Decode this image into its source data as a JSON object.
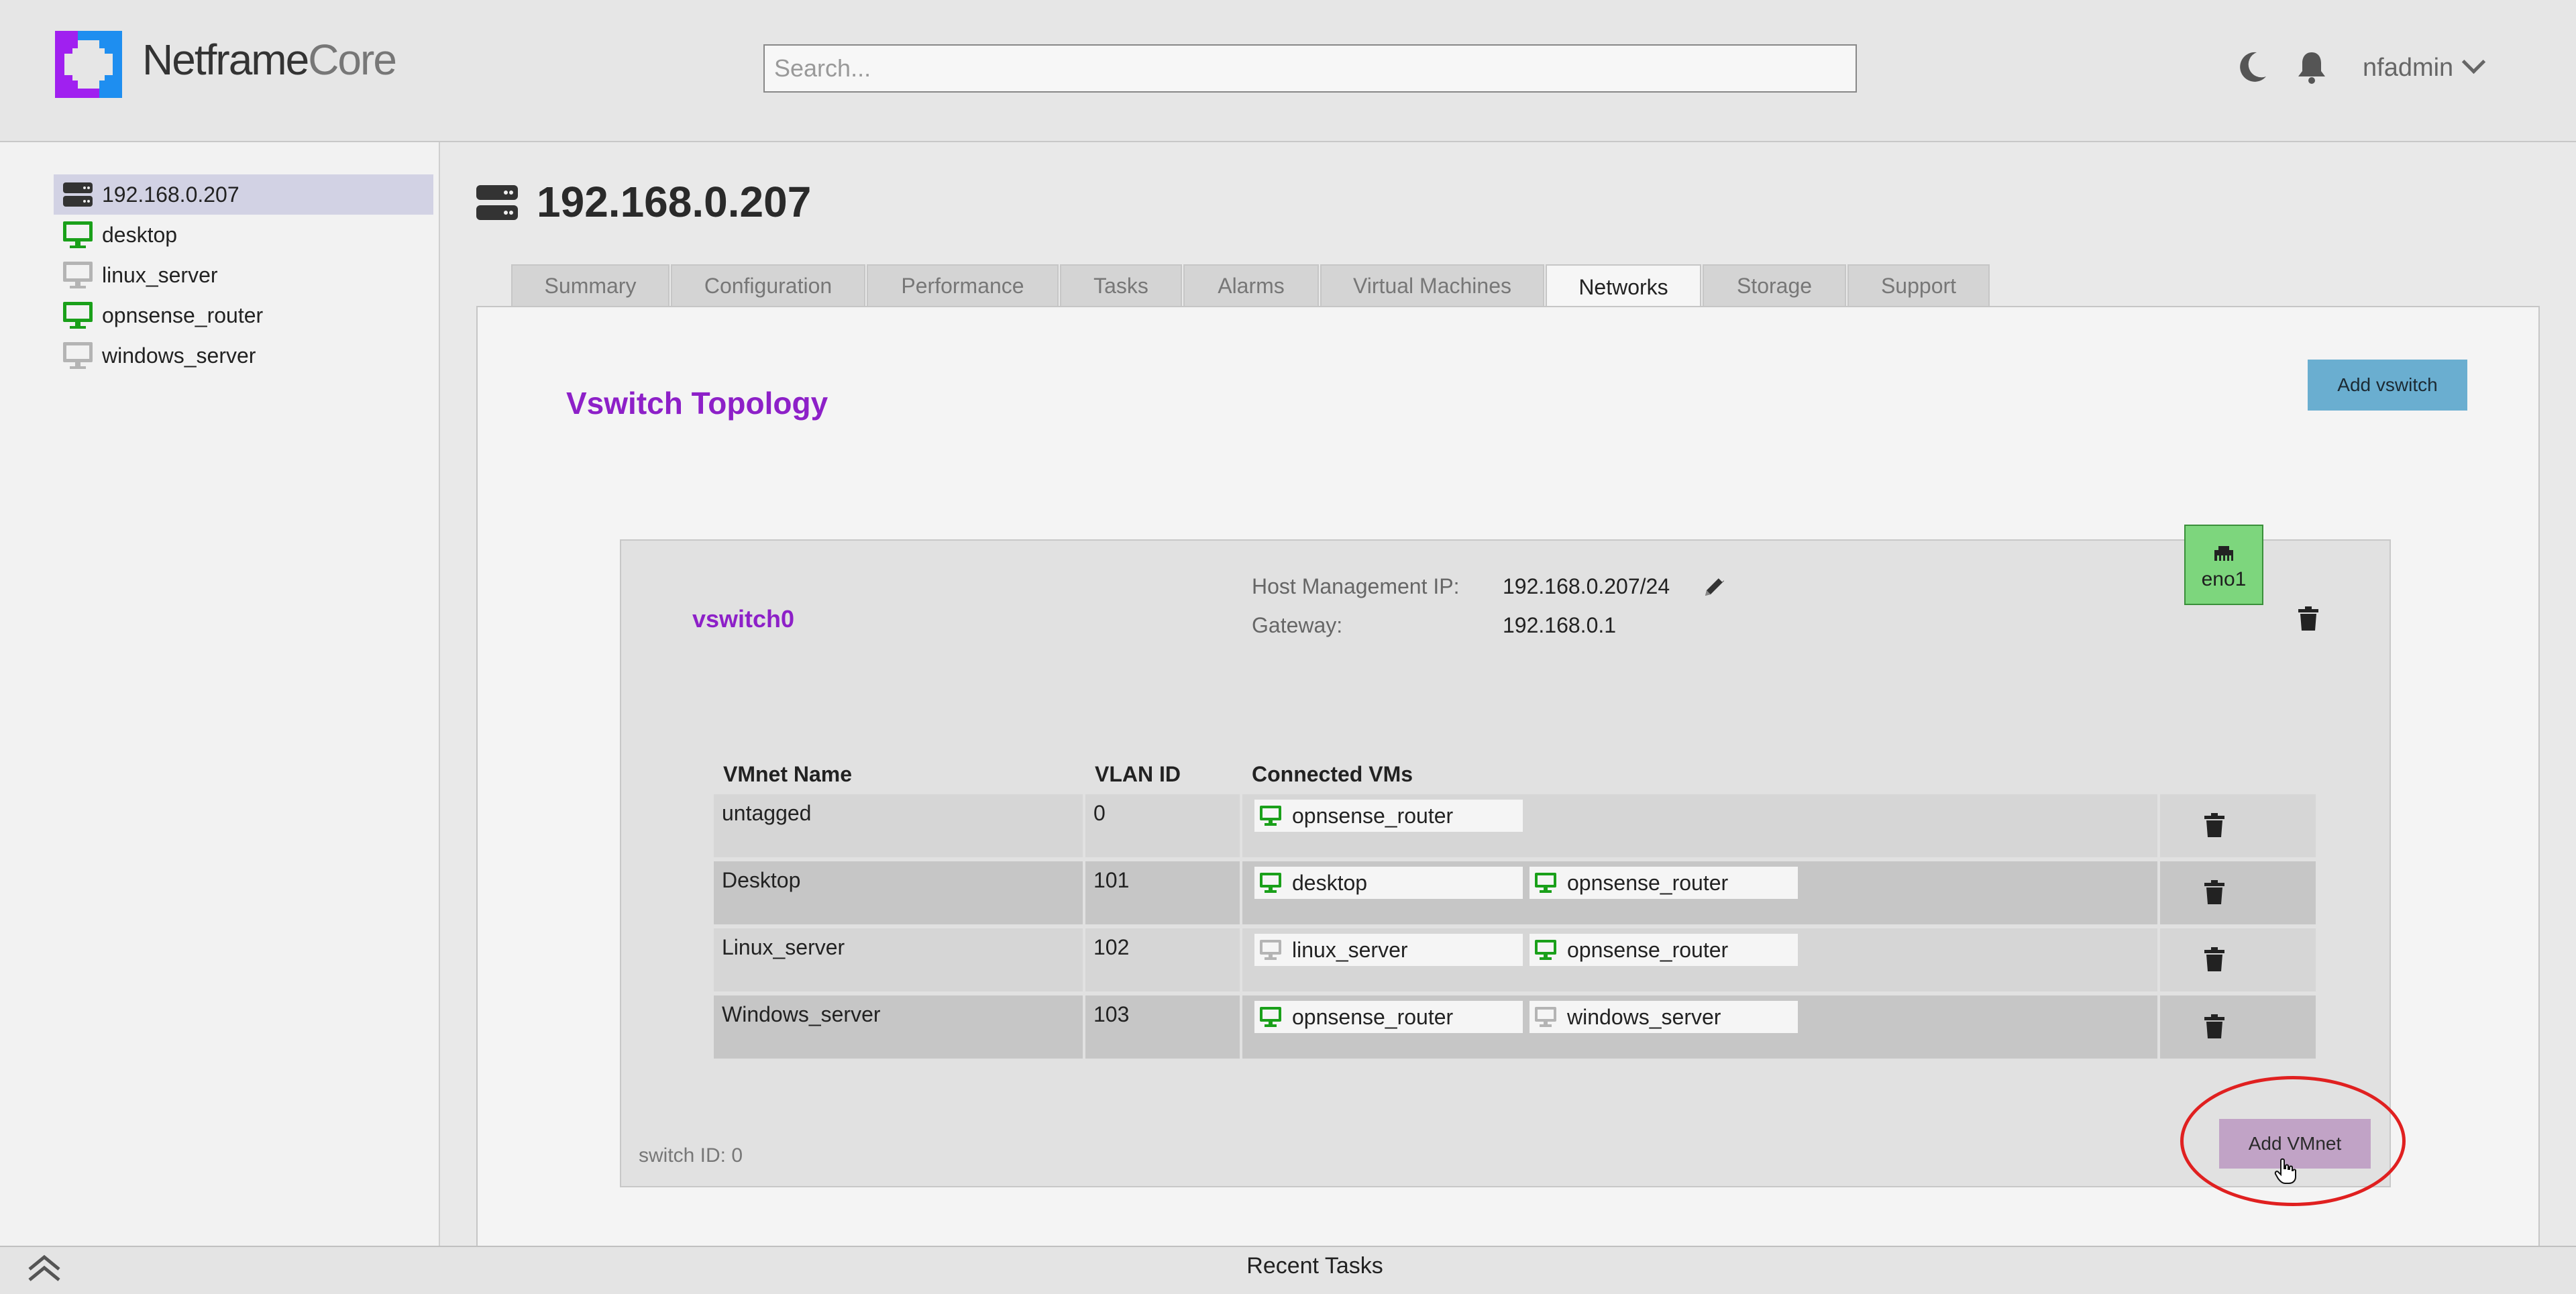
{
  "app": {
    "brand_primary": "Netframe",
    "brand_secondary": "Core",
    "search_placeholder": "Search...",
    "user": "nfadmin"
  },
  "sidebar": {
    "items": [
      {
        "label": "192.168.0.207",
        "icon": "server-icon",
        "selected": true
      },
      {
        "label": "desktop",
        "icon": "monitor-icon",
        "status": "running"
      },
      {
        "label": "linux_server",
        "icon": "monitor-icon",
        "status": "stopped"
      },
      {
        "label": "opnsense_router",
        "icon": "monitor-icon",
        "status": "running"
      },
      {
        "label": "windows_server",
        "icon": "monitor-icon",
        "status": "stopped"
      }
    ]
  },
  "page": {
    "title": "192.168.0.207",
    "tabs": [
      {
        "label": "Summary"
      },
      {
        "label": "Configuration"
      },
      {
        "label": "Performance"
      },
      {
        "label": "Tasks"
      },
      {
        "label": "Alarms"
      },
      {
        "label": "Virtual Machines"
      },
      {
        "label": "Networks",
        "active": true
      },
      {
        "label": "Storage"
      },
      {
        "label": "Support"
      }
    ]
  },
  "networks": {
    "section_title": "Vswitch Topology",
    "add_vswitch_label": "Add vswitch",
    "vswitch": {
      "name": "vswitch0",
      "mgmt_ip_label": "Host Management IP:",
      "mgmt_ip": "192.168.0.207/24",
      "gateway_label": "Gateway:",
      "gateway": "192.168.0.1",
      "nic": "eno1",
      "switch_id_text": "switch ID: 0",
      "add_vmnet_label": "Add VMnet",
      "columns": [
        "VMnet Name",
        "VLAN ID",
        "Connected VMs"
      ],
      "vmnets": [
        {
          "name": "untagged",
          "vlan": "0",
          "vms": [
            {
              "name": "opnsense_router",
              "status": "running"
            }
          ]
        },
        {
          "name": "Desktop",
          "vlan": "101",
          "vms": [
            {
              "name": "desktop",
              "status": "running"
            },
            {
              "name": "opnsense_router",
              "status": "running"
            }
          ]
        },
        {
          "name": "Linux_server",
          "vlan": "102",
          "vms": [
            {
              "name": "linux_server",
              "status": "stopped"
            },
            {
              "name": "opnsense_router",
              "status": "running"
            }
          ]
        },
        {
          "name": "Windows_server",
          "vlan": "103",
          "vms": [
            {
              "name": "opnsense_router",
              "status": "running"
            },
            {
              "name": "windows_server",
              "status": "stopped"
            }
          ]
        }
      ]
    }
  },
  "footer": {
    "label": "Recent Tasks"
  },
  "colors": {
    "accent_purple": "#8d20c8",
    "vm_running": "#1aa01a",
    "vm_stopped": "#b4b4b4",
    "nic_green": "#7dd67d",
    "add_vswitch_blue": "#6aaed0",
    "add_vmnet_mauve": "#c1a3c6",
    "highlight_red": "#e02020"
  }
}
